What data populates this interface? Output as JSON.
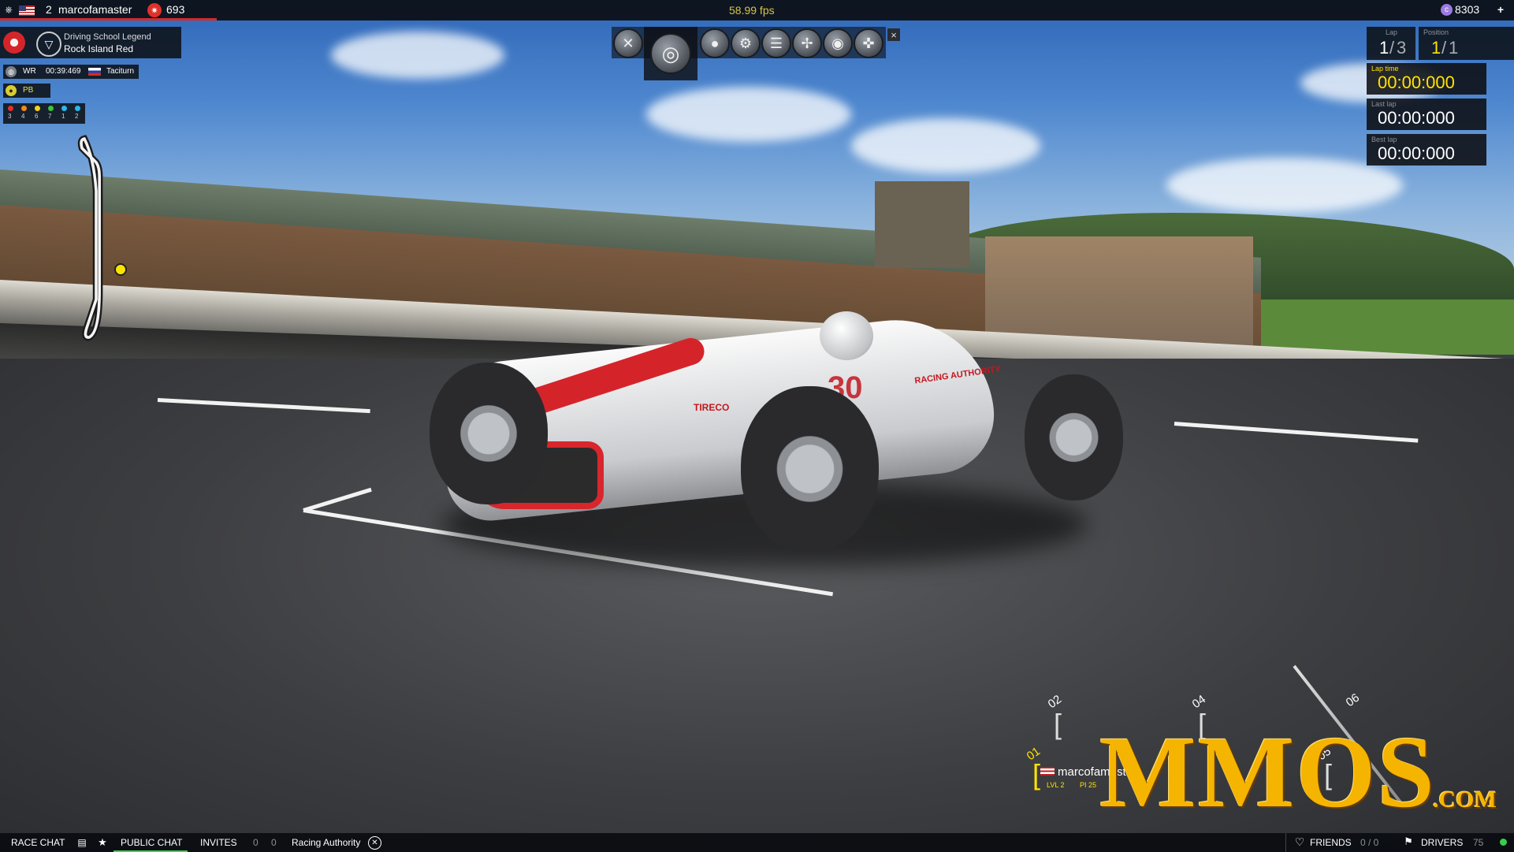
{
  "topbar": {
    "rank": "2",
    "username": "marcofamaster",
    "points": "693",
    "fps": "58.99 fps",
    "currency": "8303"
  },
  "event": {
    "title": "Driving School Legend",
    "car": "Rock Island Red",
    "wr_label": "WR",
    "wr_time": "00:39:469",
    "wr_driver": "Taciturn",
    "pb_label": "PB",
    "dots": [
      {
        "color": "#e0312c",
        "num": "3"
      },
      {
        "color": "#f08a1c",
        "num": "4"
      },
      {
        "color": "#f2d21e",
        "num": "6"
      },
      {
        "color": "#3ec33c",
        "num": "7"
      },
      {
        "color": "#2db6e6",
        "num": "1"
      },
      {
        "color": "#2db6e6",
        "num": "2"
      }
    ]
  },
  "toolbar": {
    "items": [
      "close-x-icon",
      "target-icon",
      "disc-icon",
      "gear-icon",
      "list-icon",
      "wrench-icon",
      "camera-icon",
      "steering-icon"
    ],
    "close": "×"
  },
  "race": {
    "lap_label": "Lap",
    "lap_cur": "1",
    "lap_total": "3",
    "pos_label": "Position",
    "pos_cur": "1",
    "pos_total": "1",
    "lap_time_label": "Lap time",
    "lap_time": "00:00:000",
    "last_lap_label": "Last lap",
    "last_lap": "00:00:000",
    "best_lap_label": "Best lap",
    "best_lap": "00:00:000"
  },
  "grid": {
    "slot1": "01",
    "slot2": "02",
    "slot4": "04",
    "slot5": "05",
    "slot6": "06",
    "driver": "marcofamaster",
    "lvl_label": "LVL",
    "lvl": "2",
    "pi_label": "PI",
    "pi": "25"
  },
  "car": {
    "sponsor1": "TIRECO",
    "sponsor2": "RACING AUTHORITY",
    "number": "30"
  },
  "bottombar": {
    "race_chat": "RACE CHAT",
    "public_chat": "PUBLIC CHAT",
    "invites": "INVITES",
    "inv_a": "0",
    "inv_b": "0",
    "club": "Racing Authority",
    "friends": "FRIENDS",
    "friends_count": "0 / 0",
    "drivers": "DRIVERS",
    "drivers_count": "75"
  },
  "watermark": {
    "text": "MMOS",
    "suffix": ".COM"
  },
  "colors": {
    "accent_yellow": "#ffe300",
    "hud_bg": "#0c0e12",
    "status_green": "#35d04a"
  }
}
